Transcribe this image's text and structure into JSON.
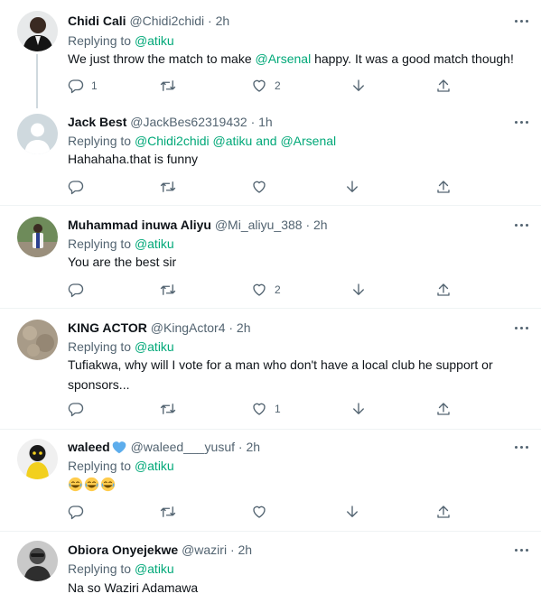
{
  "accent_color": "#00a878",
  "replying_prefix": "Replying to",
  "tweets": [
    {
      "name": "Chidi Cali",
      "handle": "@Chidi2chidi",
      "time": "· 2h",
      "verified": false,
      "mentions": [
        "@atiku"
      ],
      "text_before": "We just throw the match to make ",
      "text_link": "@Arsenal",
      "text_after": " happy. It was a good match though!",
      "reply_count": "1",
      "retweet_count": "",
      "like_count": "2",
      "avatar": "man-in-suit"
    },
    {
      "name": "Jack Best",
      "handle": "@JackBes62319432",
      "time": "· 1h",
      "verified": false,
      "mention_1": "@Chidi2chidi",
      "mention_2": "@atiku",
      "mention_joiner": "and",
      "mention_3": "@Arsenal",
      "text": "Hahahaha.that is funny",
      "reply_count": "",
      "retweet_count": "",
      "like_count": "",
      "avatar": "default-avatar"
    },
    {
      "name": "Muhammad inuwa Aliyu",
      "handle": "@Mi_aliyu_388",
      "time": "· 2h",
      "verified": false,
      "mentions": [
        "@atiku"
      ],
      "text": "You are the best sir",
      "reply_count": "",
      "retweet_count": "",
      "like_count": "2",
      "avatar": "person-outdoors"
    },
    {
      "name": "KING ACTOR",
      "handle": "@KingActor4",
      "time": "· 2h",
      "verified": false,
      "mentions": [
        "@atiku"
      ],
      "text": "Tufiakwa, why will I vote for a man who don't have a local club he support or sponsors...",
      "reply_count": "",
      "retweet_count": "",
      "like_count": "1",
      "avatar": "textured-avatar"
    },
    {
      "name": "waleed",
      "handle": "@waleed___yusuf",
      "time": "· 2h",
      "verified": true,
      "mentions": [
        "@atiku"
      ],
      "text_emoji": [
        "😂",
        "😂",
        "😂"
      ],
      "reply_count": "",
      "retweet_count": "",
      "like_count": "",
      "avatar": "yellow-character"
    },
    {
      "name": "Obiora Onyejekwe",
      "handle": "@waziri",
      "time": "· 2h",
      "verified": false,
      "mentions": [
        "@atiku"
      ],
      "text": "Na so Waziri Adamawa",
      "avatar": "bw-portrait"
    }
  ]
}
